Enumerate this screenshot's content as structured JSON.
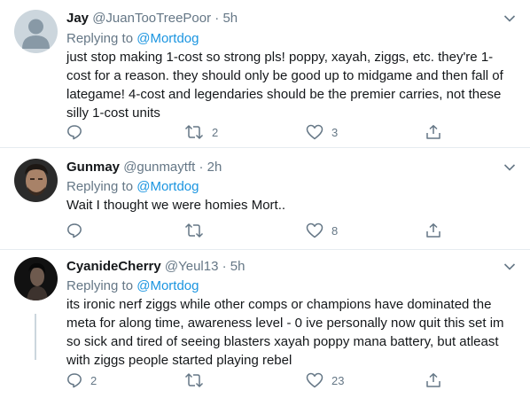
{
  "tweets": [
    {
      "name": "Jay",
      "handle": "@JuanTooTreePoor",
      "time": "· 5h",
      "replying_to_label": "Replying to",
      "mention": "@Mortdog",
      "text": "just stop making 1-cost so strong pls! poppy, xayah, ziggs, etc. they're 1-cost for a reason. they should only be good up to midgame and then fall of lategame! 4-cost and legendaries should be the premier carries, not these silly 1-cost units",
      "reply_count": "",
      "retweet_count": "2",
      "like_count": "3"
    },
    {
      "name": "Gunmay",
      "handle": "@gunmaytft",
      "time": "· 2h",
      "replying_to_label": "Replying to",
      "mention": "@Mortdog",
      "text": "Wait I thought we were homies Mort..",
      "reply_count": "",
      "retweet_count": "",
      "like_count": "8"
    },
    {
      "name": "CyanideCherry",
      "handle": "@Yeul13",
      "time": "· 5h",
      "replying_to_label": "Replying to",
      "mention": "@Mortdog",
      "text": "its ironic nerf ziggs while other comps or champions have dominated the meta for along time, awareness level - 0   ive personally now quit this set im so sick and tired of seeing blasters xayah poppy  mana battery, but atleast with ziggs people started playing rebel",
      "reply_count": "2",
      "retweet_count": "",
      "like_count": "23"
    }
  ],
  "icons": {
    "reply": "reply-icon",
    "retweet": "retweet-icon",
    "like": "like-icon",
    "share": "share-icon",
    "more": "chevron-down-icon"
  },
  "colors": {
    "link": "#1b95e0",
    "muted": "#657786",
    "text": "#14171a",
    "divider": "#e6ecf0"
  }
}
